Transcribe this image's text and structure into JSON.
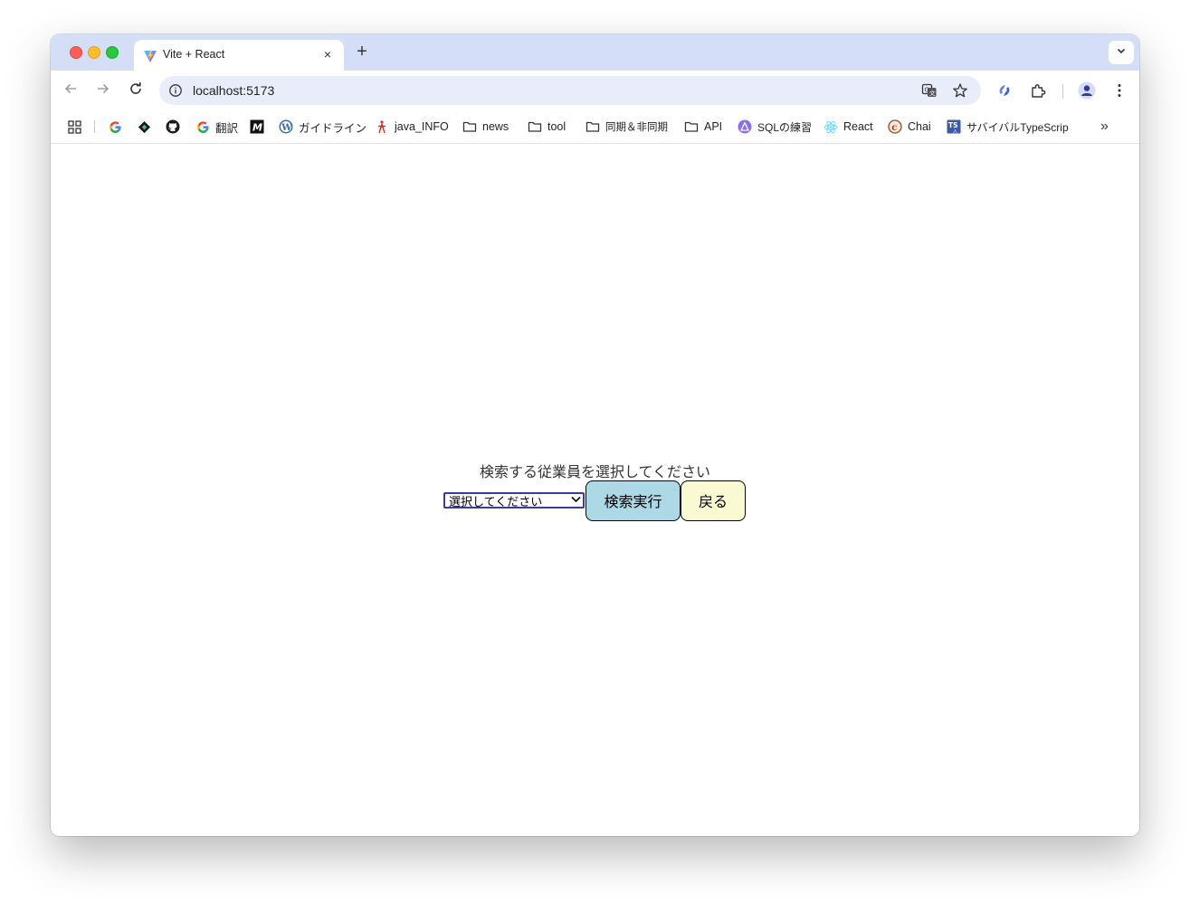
{
  "browser": {
    "tab": {
      "title": "Vite + React",
      "close_glyph": "×",
      "favicon": "vite-logo-icon"
    },
    "new_tab_glyph": "+",
    "address": {
      "url": "localhost:5173"
    },
    "bookmarks": [
      {
        "label": "",
        "icon": "google-icon"
      },
      {
        "label": "",
        "icon": "diamond-icon"
      },
      {
        "label": "",
        "icon": "github-icon"
      },
      {
        "label": "翻訳",
        "icon": "google-icon"
      },
      {
        "label": "",
        "icon": "m-logo-icon"
      },
      {
        "label": "ガイドライン",
        "icon": "wordpress-icon"
      },
      {
        "label": "java_INFO",
        "icon": "java-icon"
      },
      {
        "label": "news",
        "icon": "folder-icon"
      },
      {
        "label": "tool",
        "icon": "folder-icon"
      },
      {
        "label": "同期＆非同期",
        "icon": "folder-icon"
      },
      {
        "label": "API",
        "icon": "folder-icon"
      },
      {
        "label": "SQLの練習",
        "icon": "sql-icon"
      },
      {
        "label": "React",
        "icon": "react-icon"
      },
      {
        "label": "Chai",
        "icon": "chai-icon"
      },
      {
        "label": "サバイバルTypeScrip",
        "icon": "ts-icon"
      }
    ],
    "bookmarks_overflow_glyph": "»"
  },
  "page": {
    "prompt": "検索する従業員を選択してください",
    "select": {
      "selected": "選択してください"
    },
    "search_button": "検索実行",
    "back_button": "戻る"
  },
  "colors": {
    "tabstrip": "#d5def7",
    "omnibox": "#e8edf9",
    "search_button": "#add8e6",
    "back_button": "#fafad2"
  }
}
